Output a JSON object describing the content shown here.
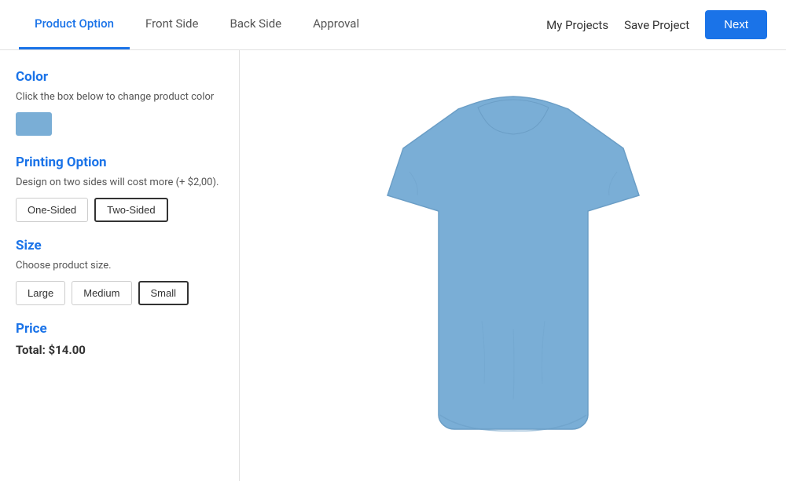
{
  "header": {
    "tabs": [
      {
        "id": "product-option",
        "label": "Product Option",
        "active": true
      },
      {
        "id": "front-side",
        "label": "Front Side",
        "active": false
      },
      {
        "id": "back-side",
        "label": "Back Side",
        "active": false
      },
      {
        "id": "approval",
        "label": "Approval",
        "active": false
      }
    ],
    "my_projects_label": "My Projects",
    "save_project_label": "Save Project",
    "next_label": "Next"
  },
  "sidebar": {
    "color_section": {
      "title": "Color",
      "description": "Click the box below to change product color",
      "swatch_color": "#7aaed6"
    },
    "printing_section": {
      "title": "Printing Option",
      "description": "Design on two sides will cost more (+ $2,00).",
      "options": [
        {
          "id": "one-sided",
          "label": "One-Sided",
          "selected": false
        },
        {
          "id": "two-sided",
          "label": "Two-Sided",
          "selected": true
        }
      ]
    },
    "size_section": {
      "title": "Size",
      "description": "Choose product size.",
      "options": [
        {
          "id": "large",
          "label": "Large",
          "selected": false
        },
        {
          "id": "medium",
          "label": "Medium",
          "selected": false
        },
        {
          "id": "small",
          "label": "Small",
          "selected": true
        }
      ]
    },
    "price_section": {
      "title": "Price",
      "total_label": "Total: $14.00"
    }
  },
  "preview": {
    "tshirt_color": "#7aaed6"
  }
}
